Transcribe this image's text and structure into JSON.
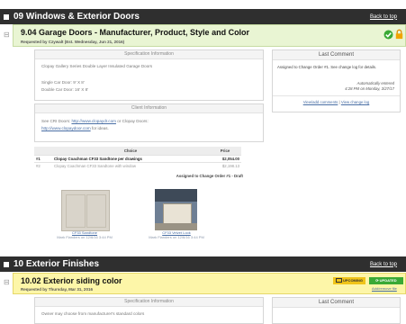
{
  "section1": {
    "title": "09 Windows & Exterior Doors",
    "back": "Back to top"
  },
  "item1": {
    "title": "9.04 Garage Doors - Manufacturer, Product, Style and Color",
    "requested": "Requested by Czywalt (Est. Wednesday, Jun 21, 2016)",
    "spec_header": "Specification Information",
    "spec_lines": [
      "Clopay Gallery Series Double Layer Insulated Garage Doors",
      "Single Car Door: 9' X 8'",
      "Double Car Door: 16' X 8'"
    ],
    "client_header": "Client Information",
    "client_line1_pre": "See CRI Doors: ",
    "client_line1_link": "http://www.clopaydr.com",
    "client_line1_post": " or Clopay Doors:",
    "client_line2_link": "http://www.clopaydoor.com",
    "client_line2_post": " for ideas.",
    "table": {
      "headers": [
        "Choice",
        "Price"
      ],
      "rows": [
        {
          "num": "#1",
          "choice": "Clopay Coachman CF33 Sandtone per drawings",
          "price": "$2,054.00"
        },
        {
          "num": "#2",
          "choice": "Clopay Coachman CF33 Sandtone with window",
          "price": "$2,198.13"
        }
      ]
    },
    "assigned": "Assigned to Change Order #1 - Draft",
    "thumbs": [
      {
        "name": "CF33 Sandtone",
        "meta": "Mark Flanders on 12/6/16 3:44 PM"
      },
      {
        "name": "CF33 Velvet Look",
        "meta": "Mark Flanders on 12/6/16 3:44 PM"
      }
    ],
    "comment": {
      "header": "Last Comment",
      "text": "Assigned to Change Order #1. See change log for details.",
      "auto": "Automatically entered",
      "when": "4:28 PM on Monday, 3/27/17",
      "link1": "View/add comments",
      "sep": " | ",
      "link2": "View change log"
    }
  },
  "section2": {
    "title": "10 Exterior Finishes",
    "back": "Back to top"
  },
  "item2": {
    "title": "10.02 Exterior siding color",
    "requested": "Requested by Thursday, Mar 31, 2016",
    "badge1": "UPCOMING",
    "badge2": "UPDATED",
    "badge_link": "Add/remove file",
    "spec_header": "Specification Information",
    "spec_line": "Owner may choose from manufacturer's standard colors",
    "comment_header": "Last Comment"
  },
  "colors": {
    "bar": "#2f2f2f",
    "green_hdr": "#e9f5d3",
    "yellow_hdr": "#fdf6a8",
    "link": "#4a6fa5",
    "upcoming": "#f0c419",
    "updated": "#3aa935"
  }
}
